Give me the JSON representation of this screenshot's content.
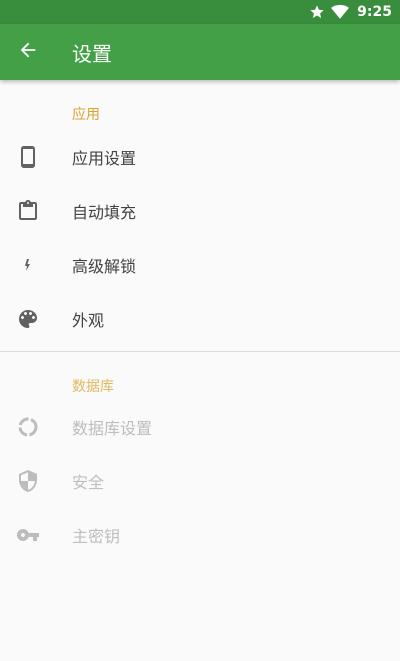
{
  "status_bar": {
    "time": "9:25",
    "icons": [
      "star-icon",
      "wifi-icon"
    ]
  },
  "app_bar": {
    "title": "设置",
    "back_icon": "arrow-back-icon"
  },
  "categories": [
    {
      "title": "应用",
      "enabled": true,
      "items": [
        {
          "label": "应用设置",
          "icon": "phone-icon"
        },
        {
          "label": "自动填充",
          "icon": "clipboard-icon"
        },
        {
          "label": "高级解锁",
          "icon": "flash-icon"
        },
        {
          "label": "外观",
          "icon": "palette-icon"
        }
      ]
    },
    {
      "title": "数据库",
      "enabled": false,
      "items": [
        {
          "label": "数据库设置",
          "icon": "database-ring-icon"
        },
        {
          "label": "安全",
          "icon": "shield-icon"
        },
        {
          "label": "主密钥",
          "icon": "key-icon"
        }
      ]
    }
  ],
  "colors": {
    "status_bar": "#388e3c",
    "app_bar": "#43a047",
    "category_accent": "#d8a534",
    "enabled_icon": "#616161",
    "disabled_icon": "#bdbdbd"
  }
}
